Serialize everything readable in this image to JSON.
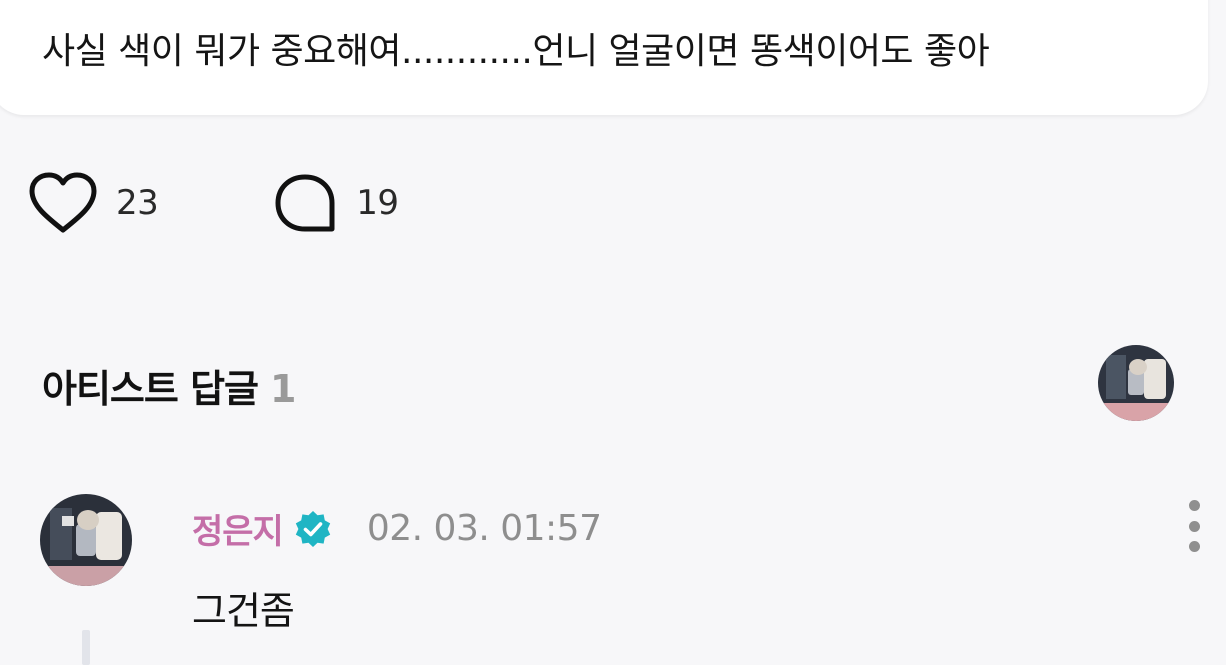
{
  "post": {
    "text": "사실 색이 뭐가 중요해여............언니 얼굴이면 똥색이어도 좋아"
  },
  "actions": {
    "likes_count": "23",
    "comments_count": "19"
  },
  "artist_replies": {
    "title": "아티스트 답글",
    "count": "1"
  },
  "comment": {
    "author": "정은지",
    "timestamp": "02. 03. 01:57",
    "body": "그건좀"
  },
  "colors": {
    "author": "#c46ea8",
    "verified_badge": "#1fb5c4",
    "count_muted": "#9a9a9a",
    "timestamp": "#8e8e8e"
  },
  "icons": {
    "like": "heart-icon",
    "comment": "speech-bubble-icon",
    "verified": "verified-badge-icon",
    "more": "more-vertical-icon"
  }
}
